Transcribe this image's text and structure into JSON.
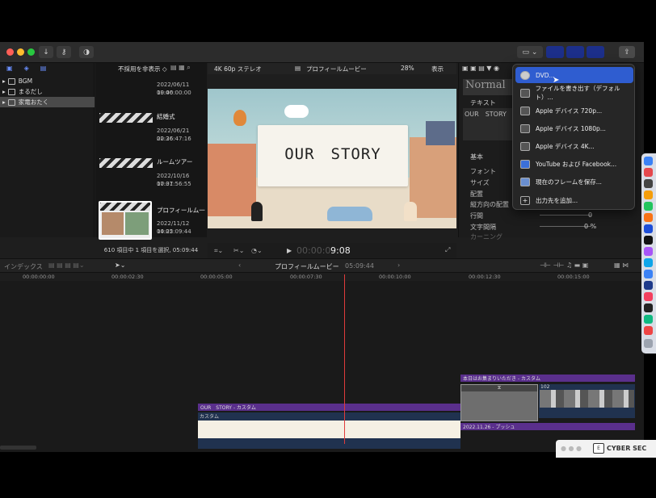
{
  "toolbar": {
    "share_icon": "share-icon"
  },
  "browser": {
    "filter_label": "不採用を非表示 ◇",
    "status": "610 項目中 1 項目を選択, 05:09:44",
    "clips": [
      {
        "name": "",
        "date": "2022/06/11 19:46",
        "duration": "00:00:00:00"
      },
      {
        "name": "結婚式",
        "date": "2022/06/21 22:36",
        "duration": "00:26:47:16"
      },
      {
        "name": "ルームツアー",
        "date": "2022/10/16 17:31",
        "duration": "00:07:56:55"
      },
      {
        "name": "プロフィールム一",
        "date": "2022/11/12 14:22",
        "duration": "00:05:09:44"
      }
    ]
  },
  "library": {
    "items": [
      "BGM",
      "まるだし",
      "家電おたく"
    ]
  },
  "viewer": {
    "format": "4K 60p ステレオ",
    "project": "プロフィールムービー",
    "zoom": "28%",
    "view_label": "表示",
    "title_text": "OUR　STORY",
    "timecode_dim": "00:00:0",
    "timecode": "9:08"
  },
  "inspector": {
    "style": "Normal",
    "text_label": "テキスト",
    "text_value": "OUR　STORY",
    "basic": "基本",
    "rows": [
      "フォント",
      "サイズ",
      "配置",
      "縦方向の配置",
      "行間",
      "文字間隔",
      "カーニング"
    ],
    "values": [
      "0",
      "0 %"
    ]
  },
  "share_menu": {
    "items": [
      "DVD...",
      "ファイルを書き出す（デフォルト）...",
      "Apple デバイス 720p...",
      "Apple デバイス 1080p...",
      "Apple デバイス 4K...",
      "YouTube および Facebook...",
      "現在のフレームを保存...",
      "出力先を追加..."
    ]
  },
  "timeline": {
    "index": "インデックス",
    "project": "プロフィールムービー",
    "duration": "05:09:44",
    "ruler": [
      "00:00:00:00",
      "00:00:02:30",
      "00:00:05:00",
      "00:00:07:30",
      "00:00:10:00",
      "00:00:12:30",
      "00:00:15:00"
    ],
    "clip_title": "OUR　STORY - カスタム",
    "clip_custom": "カスタム",
    "clip_top_right": "本日はお集まりいただき - カスタム",
    "clip_date": "2022.11.26 - プッシュ",
    "clip_num": "102"
  },
  "eset": {
    "label": "CYBER SEC"
  },
  "colors": {
    "accent": "#2f5dd0",
    "title_clip": "#5a2f8c",
    "tc_red": "#e03c3c"
  }
}
